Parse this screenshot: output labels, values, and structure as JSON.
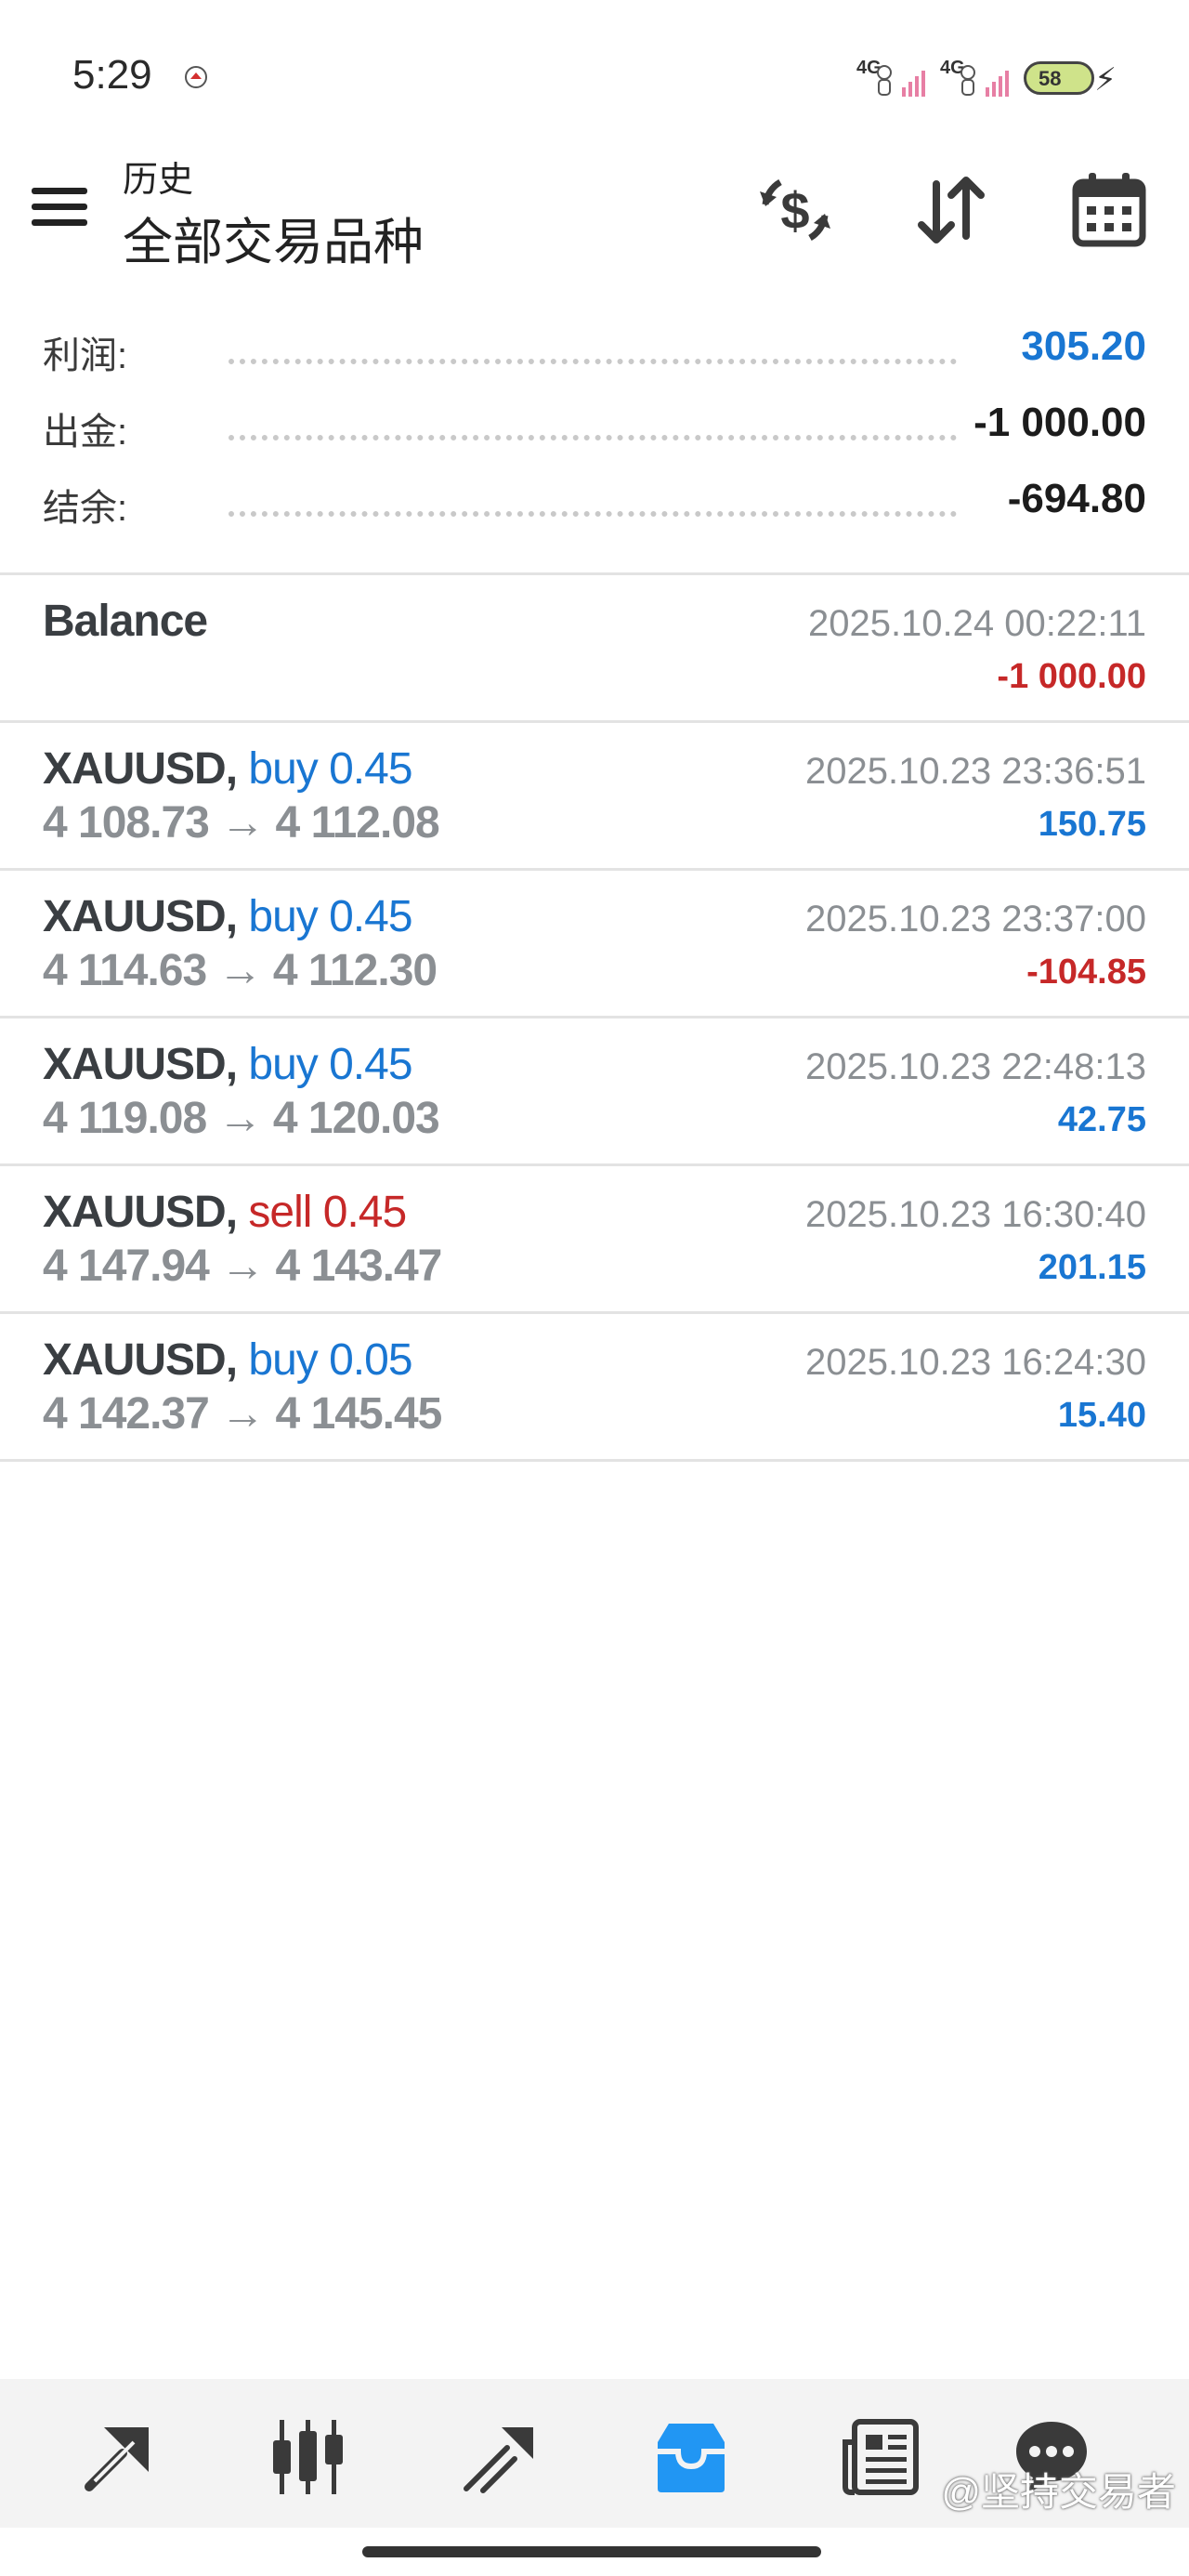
{
  "status_bar": {
    "time": "5:29",
    "network_1": "4G",
    "network_2": "4G",
    "battery": "58"
  },
  "header": {
    "subtitle": "历史",
    "title": "全部交易品种",
    "icons": [
      "exchange-dollar-icon",
      "sort-icon",
      "calendar-icon"
    ]
  },
  "summary": {
    "profit_label": "利润:",
    "profit_value": "305.20",
    "withdrawal_label": "出金:",
    "withdrawal_value": "-1 000.00",
    "balance_label": "结余:",
    "balance_value": "-694.80"
  },
  "deals": [
    {
      "title": "Balance",
      "time": "2025.10.24 00:22:11",
      "profit": "-1 000.00",
      "profit_sign": "negative"
    },
    {
      "symbol": "XAUUSD,",
      "side": "buy 0.45",
      "side_type": "buy",
      "open": "4 108.73",
      "close": "4 112.08",
      "time": "2025.10.23 23:36:51",
      "profit": "150.75",
      "profit_sign": "positive"
    },
    {
      "symbol": "XAUUSD,",
      "side": "buy 0.45",
      "side_type": "buy",
      "open": "4 114.63",
      "close": "4 112.30",
      "time": "2025.10.23 23:37:00",
      "profit": "-104.85",
      "profit_sign": "negative"
    },
    {
      "symbol": "XAUUSD,",
      "side": "buy 0.45",
      "side_type": "buy",
      "open": "4 119.08",
      "close": "4 120.03",
      "time": "2025.10.23 22:48:13",
      "profit": "42.75",
      "profit_sign": "positive"
    },
    {
      "symbol": "XAUUSD,",
      "side": "sell 0.45",
      "side_type": "sell",
      "open": "4 147.94",
      "close": "4 143.47",
      "time": "2025.10.23 16:30:40",
      "profit": "201.15",
      "profit_sign": "positive"
    },
    {
      "symbol": "XAUUSD,",
      "side": "buy 0.05",
      "side_type": "buy",
      "open": "4 142.37",
      "close": "4 145.45",
      "time": "2025.10.23 16:24:30",
      "profit": "15.40",
      "profit_sign": "positive"
    }
  ],
  "price_arrow": "→",
  "bottom_nav": {
    "items": [
      "quotes-icon",
      "chart-icon",
      "trade-icon",
      "history-icon",
      "news-icon",
      "chat-icon"
    ],
    "active": "history-icon"
  },
  "watermark": "@坚持交易者",
  "colors": {
    "blue": "#1976d2",
    "red": "#c62828",
    "gray_text": "#8b8f93",
    "dark_text": "#3a3e42",
    "nav_bg": "#f3f3f3"
  }
}
